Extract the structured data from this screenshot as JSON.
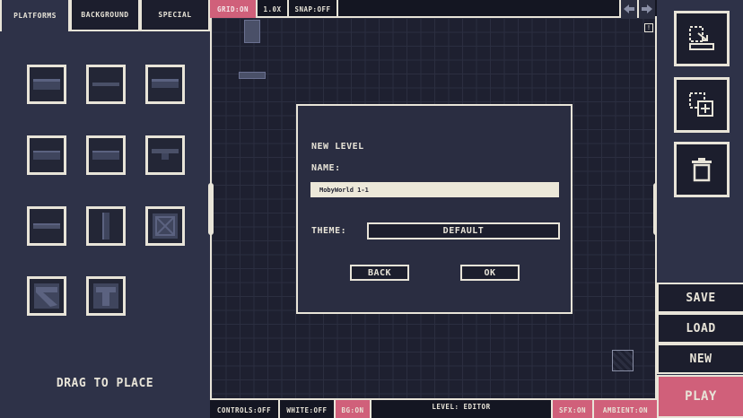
{
  "left_panel": {
    "tabs": [
      {
        "label": "PLATFORMS",
        "active": true
      },
      {
        "label": "BACKGROUND",
        "active": false
      },
      {
        "label": "SPECIAL",
        "active": false
      }
    ],
    "drag_hint": "DRAG TO PLACE"
  },
  "top_bar": {
    "grid": "GRID:ON",
    "zoom": "1.0X",
    "snap": "SNAP:OFF",
    "prev_icon": "arrow-left-icon",
    "next_icon": "arrow-right-icon",
    "info_icon": "info-icon"
  },
  "bottom_bar": {
    "controls": "CONTROLS:OFF",
    "white": "WHITE:OFF",
    "bg": "BG:ON",
    "level": "LEVEL: EDITOR",
    "sfx": "SFX:ON",
    "ambient": "AMBIENT:ON"
  },
  "right_panel": {
    "tools": [
      {
        "icon": "import-level-icon"
      },
      {
        "icon": "add-selection-icon"
      },
      {
        "icon": "trash-icon"
      }
    ],
    "save": "SAVE",
    "load": "LOAD",
    "new": "NEW",
    "play": "PLAY"
  },
  "dialog": {
    "title": "NEW LEVEL",
    "name_label": "NAME:",
    "name_value": "MobyWorld 1-1",
    "theme_label": "THEME:",
    "theme_value": "DEFAULT",
    "back": "BACK",
    "ok": "OK"
  },
  "colors": {
    "accent": "#d0607a",
    "panel": "#2e3248",
    "canvas": "#1e2030",
    "outline": "#e8e4d8"
  }
}
